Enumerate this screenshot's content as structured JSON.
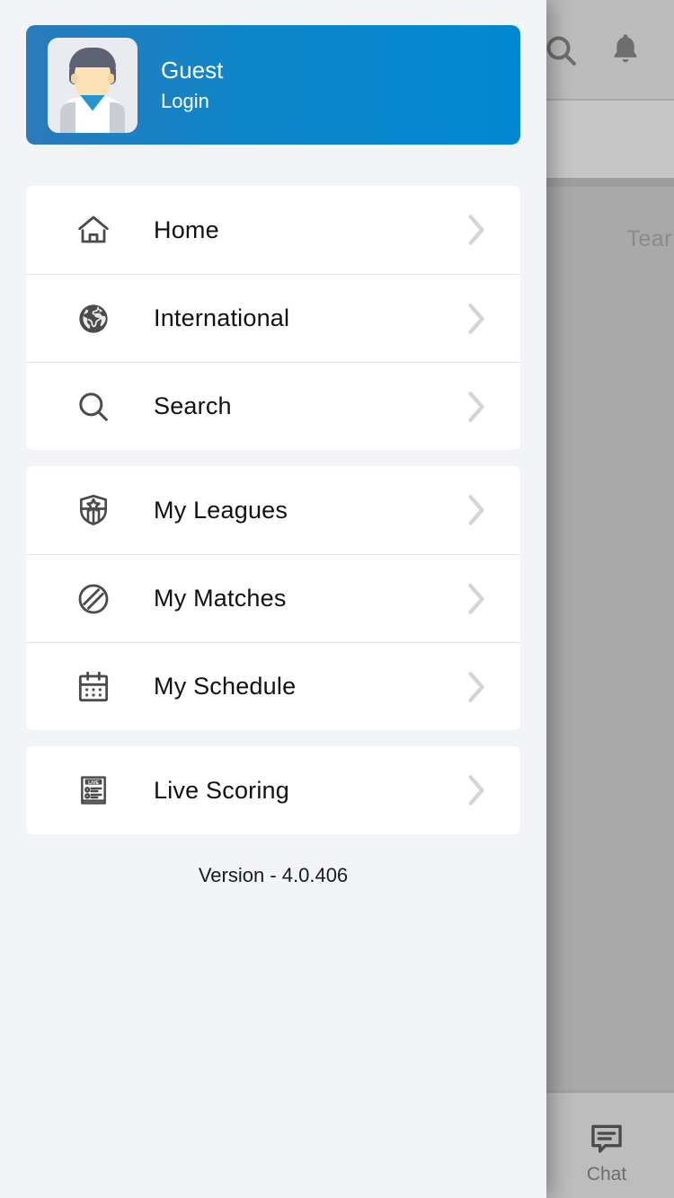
{
  "drawer": {
    "profile": {
      "name": "Guest",
      "action": "Login",
      "avatar_icon": "user-avatar-icon",
      "gradient_start": "#2b7bba",
      "gradient_end": "#0288d1"
    },
    "groups": [
      {
        "items": [
          {
            "label": "Home",
            "icon": "home-icon",
            "chevron": "chevron-right-icon"
          },
          {
            "label": "International",
            "icon": "globe-icon",
            "chevron": "chevron-right-icon"
          },
          {
            "label": "Search",
            "icon": "search-icon",
            "chevron": "chevron-right-icon"
          }
        ]
      },
      {
        "items": [
          {
            "label": "My Leagues",
            "icon": "shield-star-icon",
            "chevron": "chevron-right-icon"
          },
          {
            "label": "My Matches",
            "icon": "circle-slash-icon",
            "chevron": "chevron-right-icon"
          },
          {
            "label": "My Schedule",
            "icon": "calendar-icon",
            "chevron": "chevron-right-icon"
          }
        ]
      },
      {
        "items": [
          {
            "label": "Live Scoring",
            "icon": "live-scoreboard-icon",
            "chevron": "chevron-right-icon"
          }
        ]
      }
    ],
    "version": "Version - 4.0.406"
  },
  "background_app": {
    "search_icon": "search-icon",
    "notifications_icon": "bell-icon",
    "tab_label": "Tear",
    "chat_tab": {
      "label": "Chat",
      "icon": "chat-bubble-icon"
    },
    "overlay_color": "#a9a9a9"
  }
}
